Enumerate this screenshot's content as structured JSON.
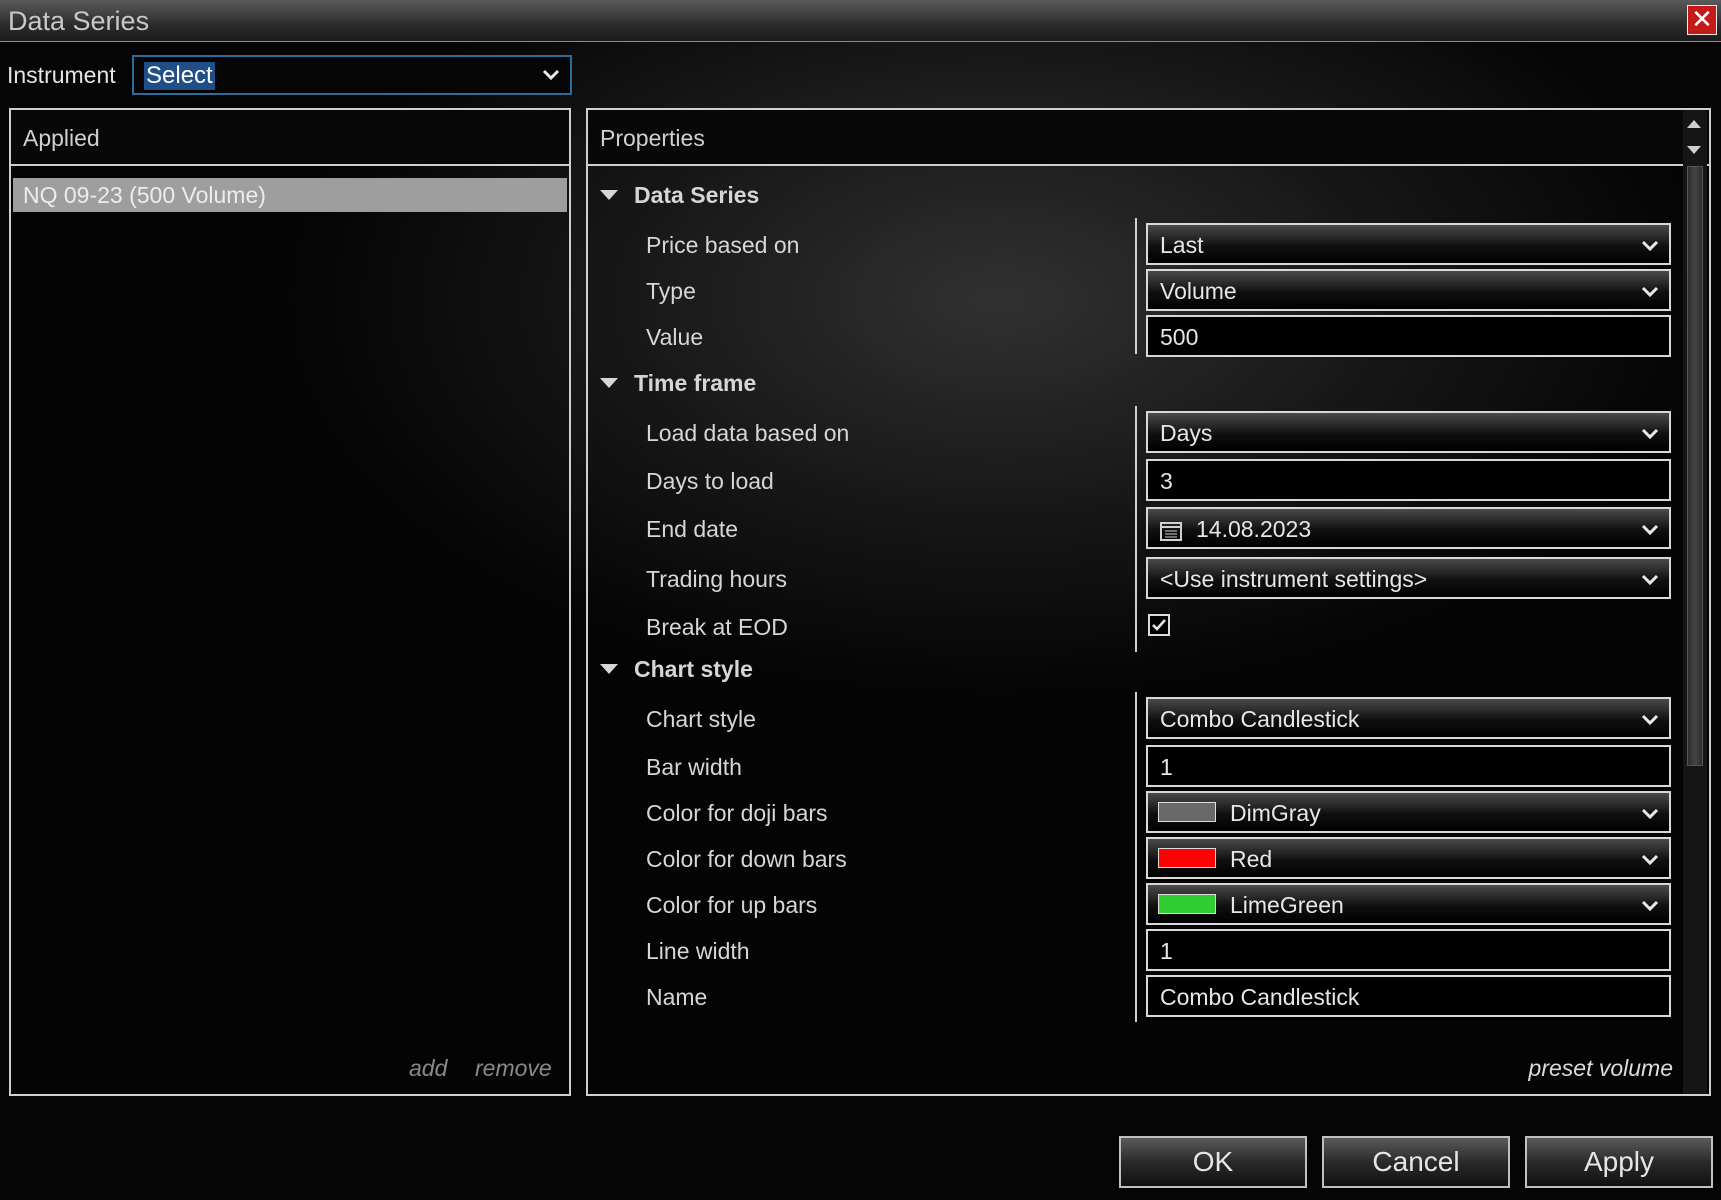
{
  "window": {
    "title": "Data Series",
    "close_label": "✕"
  },
  "instrument": {
    "label": "Instrument",
    "value": "Select"
  },
  "applied": {
    "header": "Applied",
    "items": [
      "NQ 09-23 (500 Volume)"
    ],
    "add_label": "add",
    "remove_label": "remove"
  },
  "properties": {
    "header": "Properties",
    "sections": {
      "data_series": {
        "title": "Data Series",
        "price_based_on": {
          "label": "Price based on",
          "value": "Last"
        },
        "type": {
          "label": "Type",
          "value": "Volume"
        },
        "value": {
          "label": "Value",
          "value": "500"
        }
      },
      "time_frame": {
        "title": "Time frame",
        "load_data_based_on": {
          "label": "Load data based on",
          "value": "Days"
        },
        "days_to_load": {
          "label": "Days to load",
          "value": "3"
        },
        "end_date": {
          "label": "End date",
          "value": "14.08.2023"
        },
        "trading_hours": {
          "label": "Trading hours",
          "value": "<Use instrument settings>"
        },
        "break_at_eod": {
          "label": "Break at EOD",
          "checked": true
        }
      },
      "chart_style": {
        "title": "Chart style",
        "chart_style": {
          "label": "Chart style",
          "value": "Combo Candlestick"
        },
        "bar_width": {
          "label": "Bar width",
          "value": "1"
        },
        "color_doji": {
          "label": "Color for doji bars",
          "value": "DimGray",
          "color": "#696969"
        },
        "color_down": {
          "label": "Color for down bars",
          "value": "Red",
          "color": "#ff0000"
        },
        "color_up": {
          "label": "Color for up bars",
          "value": "LimeGreen",
          "color": "#32cd32"
        },
        "line_width": {
          "label": "Line width",
          "value": "1"
        },
        "name": {
          "label": "Name",
          "value": "Combo Candlestick"
        }
      }
    },
    "preset_label": "preset volume"
  },
  "buttons": {
    "ok": "OK",
    "cancel": "Cancel",
    "apply": "Apply"
  },
  "icons": {
    "close": "close-icon",
    "dropdown": "chevron-down-icon",
    "collapse": "triangle-down-icon",
    "calendar": "calendar-icon",
    "checkbox": "checkmark-icon"
  }
}
